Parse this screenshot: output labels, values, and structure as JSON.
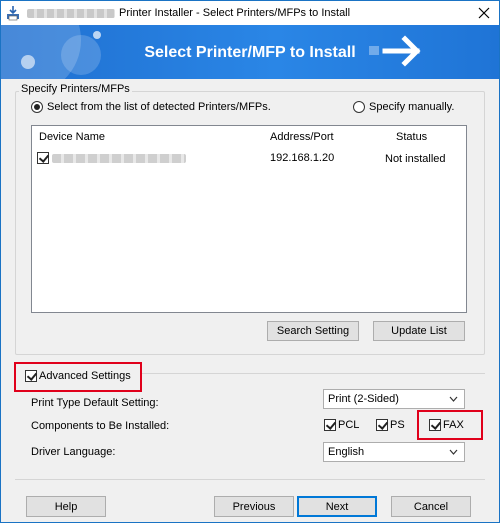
{
  "window": {
    "title": "Printer Installer - Select Printers/MFPs to Install",
    "close_icon": "close-icon",
    "app_icon": "printer-installer-icon"
  },
  "banner": {
    "title": "Select Printer/MFP to Install",
    "icon": "arrow-right-icon"
  },
  "specify": {
    "group_label": "Specify Printers/MFPs",
    "option_list": "Select from the list of detected Printers/MFPs.",
    "option_manual": "Specify manually.",
    "selected": "list"
  },
  "devices": {
    "columns": [
      "Device Name",
      "Address/Port",
      "Status"
    ],
    "rows": [
      {
        "checked": true,
        "address": "192.168.1.20",
        "status": "Not installed"
      }
    ]
  },
  "buttons": {
    "search_setting": "Search Setting",
    "update_list": "Update List",
    "help": "Help",
    "previous": "Previous",
    "next": "Next",
    "cancel": "Cancel"
  },
  "advanced": {
    "label": "Advanced Settings",
    "checked": true,
    "print_type_label": "Print Type Default Setting:",
    "print_type_value": "Print (2-Sided)",
    "components_label": "Components to Be Installed:",
    "components": [
      {
        "label": "PCL",
        "checked": true
      },
      {
        "label": "PS",
        "checked": true
      },
      {
        "label": "FAX",
        "checked": true
      }
    ],
    "language_label": "Driver Language:",
    "language_value": "English"
  },
  "colors": {
    "banner": "#2a86e6",
    "highlight_border": "#e0001b",
    "default_button_border": "#0078d7"
  }
}
